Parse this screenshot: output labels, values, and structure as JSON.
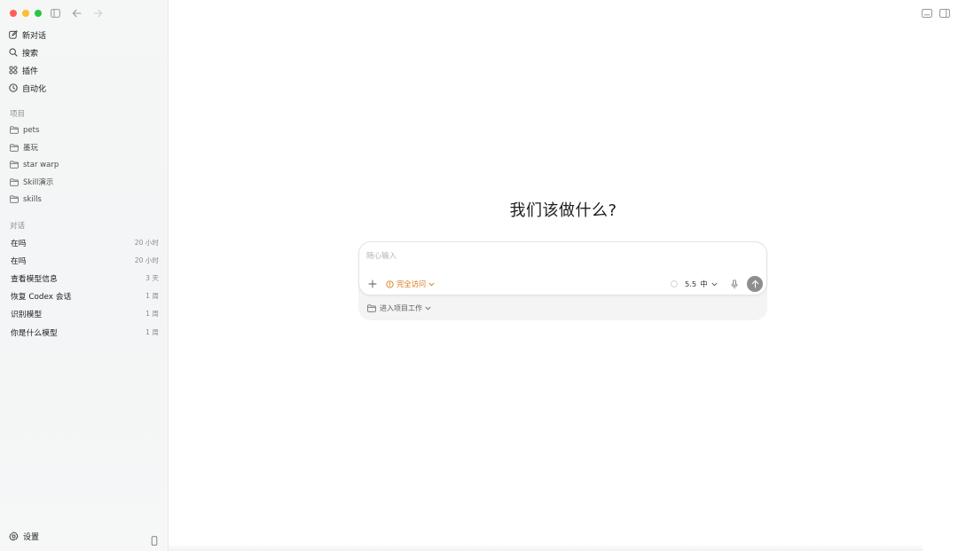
{
  "sidebar": {
    "nav": [
      {
        "label": "新对话",
        "icon": "compose-icon"
      },
      {
        "label": "搜索",
        "icon": "search-icon"
      },
      {
        "label": "插件",
        "icon": "plugins-grid-icon"
      },
      {
        "label": "自动化",
        "icon": "clock-icon"
      }
    ],
    "projects_label": "项目",
    "projects": [
      {
        "label": "pets"
      },
      {
        "label": "墨玩"
      },
      {
        "label": "star warp"
      },
      {
        "label": "Skill演示"
      },
      {
        "label": "skills"
      }
    ],
    "conversations_label": "对话",
    "conversations": [
      {
        "title": "在吗",
        "time": "20 小时"
      },
      {
        "title": "在吗",
        "time": "20 小时"
      },
      {
        "title": "查看模型信息",
        "time": "3 天"
      },
      {
        "title": "恢复 Codex 会话",
        "time": "1 周"
      },
      {
        "title": "识别模型",
        "time": "1 周"
      },
      {
        "title": "你是什么模型",
        "time": "1 周"
      }
    ],
    "settings_label": "设置"
  },
  "main": {
    "headline": "我们该做什么?",
    "composer": {
      "placeholder": "随心输入",
      "value": "",
      "access_label": "完全访问",
      "model_version": "5.5",
      "model_level": "中",
      "project_entry_label": "进入项目工作"
    }
  },
  "colors": {
    "accent_access": "#d97a1a",
    "send_button": "#8e8e8e",
    "traffic_red": "#fe5f57",
    "traffic_yellow": "#febc2e",
    "traffic_green": "#28c840"
  }
}
